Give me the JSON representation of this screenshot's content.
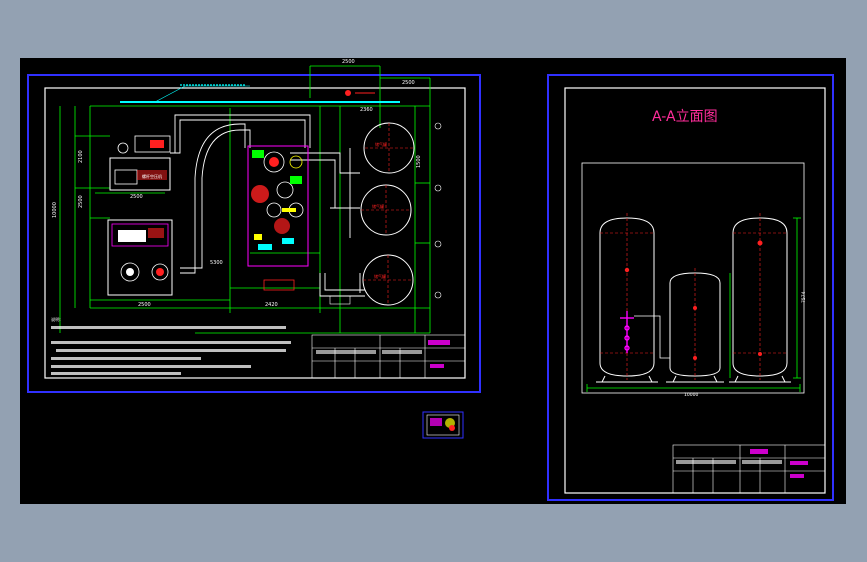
{
  "drawing": {
    "title": "A-A立面图",
    "notes": "说明:",
    "dims": {
      "plan_top": "2500",
      "plan_right_top": "2500",
      "plan_mid": "2360",
      "plan_height": "10000",
      "plan_left1": "2100",
      "plan_left2": "2500",
      "bottom1": "2500",
      "bottom2": "5300",
      "bottom3": "2500",
      "bottom4": "2420",
      "tank_dia": "1500",
      "elev_width": "10000",
      "elev_height": "7574"
    }
  },
  "colors": {
    "background": "#000000",
    "frame": "#ffffff",
    "dimension": "#00ff00",
    "piping": "#ffffff",
    "equipment": "#ff2020",
    "highlight": "#ff00ff",
    "cyan": "#00ffff",
    "blue_border": "#2020ff",
    "yellow": "#ffff00"
  }
}
